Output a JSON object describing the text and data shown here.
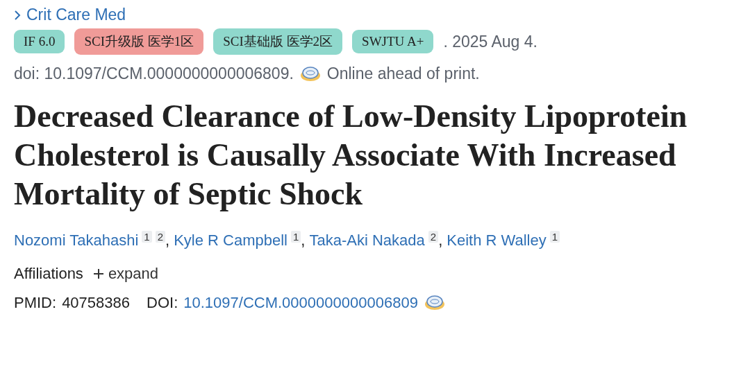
{
  "journal": {
    "name": "Crit Care Med"
  },
  "tags": [
    {
      "label": "IF 6.0",
      "color": "#8fd8cc"
    },
    {
      "label": "SCI升级版 医学1区",
      "color": "#f09b98"
    },
    {
      "label": "SCI基础版 医学2区",
      "color": "#8fd8cc"
    },
    {
      "label": "SWJTU A+",
      "color": "#8fd8cc"
    }
  ],
  "date": ". 2025 Aug 4.",
  "doi_line": "doi: 10.1097/CCM.0000000000006809.",
  "status": "Online ahead of print.",
  "title": "Decreased Clearance of Low-Density Lipoprotein Cholesterol is Causally Associate With Increased Mortality of Septic Shock",
  "authors": [
    {
      "name": "Nozomi Takahashi",
      "affiliations": [
        "1",
        "2"
      ],
      "separator": ","
    },
    {
      "name": "Kyle R Campbell",
      "affiliations": [
        "1"
      ],
      "separator": ","
    },
    {
      "name": "Taka-Aki Nakada",
      "affiliations": [
        "2"
      ],
      "separator": ","
    },
    {
      "name": "Keith R Walley",
      "affiliations": [
        "1"
      ]
    }
  ],
  "affiliations": {
    "label": "Affiliations",
    "toggle": "expand",
    "expanded": false
  },
  "identifiers": {
    "pmid_label": "PMID:",
    "pmid": "40758386",
    "doi_label": "DOI:",
    "doi": "10.1097/CCM.0000000000006809"
  }
}
